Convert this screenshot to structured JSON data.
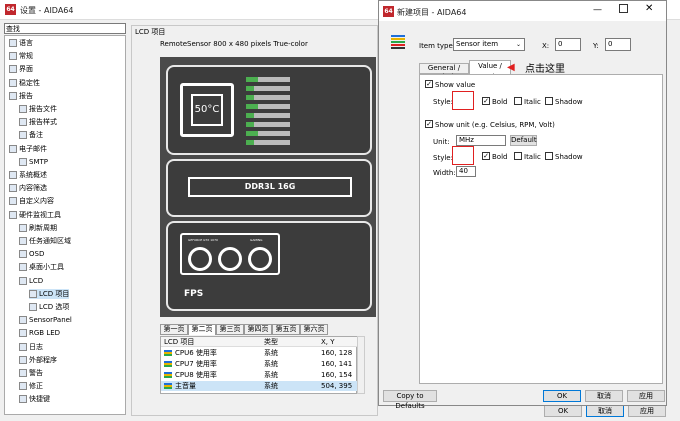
{
  "main_window": {
    "title": "设置 - AIDA64",
    "app_icon": "64",
    "search_label": "查找",
    "tree": [
      {
        "label": "语言",
        "indent": 0
      },
      {
        "label": "常规",
        "indent": 0
      },
      {
        "label": "界面",
        "indent": 0
      },
      {
        "label": "稳定性",
        "indent": 0
      },
      {
        "label": "报告",
        "indent": 0
      },
      {
        "label": "报告文件",
        "indent": 1
      },
      {
        "label": "报告样式",
        "indent": 1
      },
      {
        "label": "备注",
        "indent": 1
      },
      {
        "label": "电子邮件",
        "indent": 0
      },
      {
        "label": "SMTP",
        "indent": 1
      },
      {
        "label": "系统概述",
        "indent": 0
      },
      {
        "label": "内容筛选",
        "indent": 0
      },
      {
        "label": "自定义内容",
        "indent": 0
      },
      {
        "label": "硬件监视工具",
        "indent": 0
      },
      {
        "label": "刷新周期",
        "indent": 1
      },
      {
        "label": "任务通知区域",
        "indent": 1
      },
      {
        "label": "OSD",
        "indent": 1
      },
      {
        "label": "桌面小工具",
        "indent": 1
      },
      {
        "label": "LCD",
        "indent": 1
      },
      {
        "label": "LCD 项目",
        "indent": 2
      },
      {
        "label": "LCD 选项",
        "indent": 2
      },
      {
        "label": "SensorPanel",
        "indent": 1
      },
      {
        "label": "RGB LED",
        "indent": 1
      },
      {
        "label": "日志",
        "indent": 1
      },
      {
        "label": "外部程序",
        "indent": 1
      },
      {
        "label": "警告",
        "indent": 1
      },
      {
        "label": "修正",
        "indent": 1
      },
      {
        "label": "快捷键",
        "indent": 1
      }
    ],
    "selected_tree_item": "LCD 项目",
    "group_title": "LCD 项目",
    "lcd_caption": "RemoteSensor 800 x 480 pixels True-color",
    "lcd": {
      "temp_text": "50°C",
      "ram_text": "DDR3L 16G",
      "gpu_text_left": "GEFORCE GTX 1070",
      "gpu_text_right": "GAMING",
      "fps_text": "FPS"
    },
    "page_tabs": [
      "第一页",
      "第二页",
      "第三页",
      "第四页",
      "第五页",
      "第六页"
    ],
    "active_page_tab": "第二页",
    "table_headers": [
      "LCD 项目",
      "类型",
      "X, Y"
    ],
    "table_rows": [
      {
        "name": "CPU6 使用率",
        "type": "系统",
        "xy": "160, 128"
      },
      {
        "name": "CPU7 使用率",
        "type": "系统",
        "xy": "160, 141"
      },
      {
        "name": "CPU8 使用率",
        "type": "系统",
        "xy": "160, 154"
      },
      {
        "name": "主音量",
        "type": "系统",
        "xy": "504, 395"
      }
    ],
    "ok_label": "OK",
    "cancel_label": "取消",
    "apply_label": "应用"
  },
  "dialog": {
    "title": "新建项目 - AIDA64",
    "item_type_label": "Item type:",
    "item_type_value": "Sensor item",
    "x_label": "X:",
    "x_value": "0",
    "y_label": "Y:",
    "y_value": "0",
    "tab_general": "General / Label",
    "tab_value": "Value / Unit",
    "annotation": "点击这里",
    "show_value_label": "Show value",
    "show_value_checked": true,
    "style_label": "Style:",
    "bold_label": "Bold",
    "bold_checked": true,
    "italic_label": "Italic",
    "shadow_label": "Shadow",
    "show_unit_label": "Show unit (e.g. Celsius, RPM, Volt)",
    "show_unit_checked": true,
    "unit_label": "Unit:",
    "unit_value": "MHz",
    "default_label": "Default",
    "style2_label": "Style:",
    "bold2_label": "Bold",
    "bold2_checked": true,
    "italic2_label": "Italic",
    "shadow2_label": "Shadow",
    "width_label": "Width:",
    "width_value": "40",
    "copy_defaults_label": "Copy to Defaults",
    "ok_label": "OK",
    "cancel_label": "取消",
    "apply_label": "应用"
  },
  "colors": {
    "accent": "#0078d7",
    "annotation_red": "#e02020",
    "lcd_bg": "#3c3c3c",
    "bar_green": "#4caf50"
  }
}
